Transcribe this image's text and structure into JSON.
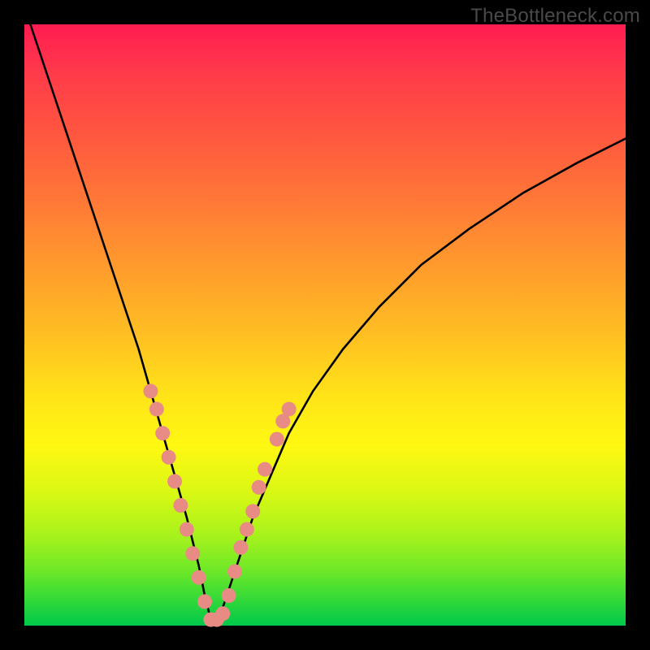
{
  "watermark": "TheBottleneck.com",
  "chart_data": {
    "type": "line",
    "title": "",
    "xlabel": "",
    "ylabel": "",
    "xlim": [
      0,
      100
    ],
    "ylim": [
      0,
      100
    ],
    "grid": false,
    "legend": false,
    "note": "Values are estimated from pixels. The line resembles an absolute-deviation / bottleneck curve with a sharp minimum near x≈31. Background gradient maps red(top)→green(bottom) to the same y-axis (high=bad, low=good).",
    "series": [
      {
        "name": "bottleneck-curve",
        "x": [
          1,
          4,
          7,
          10,
          13,
          16,
          19,
          21,
          23,
          25,
          27,
          29,
          30,
          31,
          32,
          33,
          34,
          36,
          38,
          41,
          44,
          48,
          53,
          59,
          66,
          74,
          83,
          92,
          100
        ],
        "y": [
          100,
          91,
          82,
          73,
          64,
          55,
          46,
          39,
          32,
          25,
          18,
          10,
          5,
          1,
          1,
          3,
          6,
          12,
          18,
          25,
          32,
          39,
          46,
          53,
          60,
          66,
          72,
          77,
          81
        ]
      }
    ],
    "markers": {
      "name": "highlighted-points",
      "note": "Salmon circular markers clustered near the valley on both branches.",
      "points": [
        {
          "x": 21,
          "y": 39
        },
        {
          "x": 22,
          "y": 36
        },
        {
          "x": 23,
          "y": 32
        },
        {
          "x": 24,
          "y": 28
        },
        {
          "x": 25,
          "y": 24
        },
        {
          "x": 26,
          "y": 20
        },
        {
          "x": 27,
          "y": 16
        },
        {
          "x": 28,
          "y": 12
        },
        {
          "x": 29,
          "y": 8
        },
        {
          "x": 30,
          "y": 4
        },
        {
          "x": 31,
          "y": 1
        },
        {
          "x": 32,
          "y": 1
        },
        {
          "x": 33,
          "y": 2
        },
        {
          "x": 34,
          "y": 5
        },
        {
          "x": 35,
          "y": 9
        },
        {
          "x": 36,
          "y": 13
        },
        {
          "x": 37,
          "y": 16
        },
        {
          "x": 38,
          "y": 19
        },
        {
          "x": 39,
          "y": 23
        },
        {
          "x": 40,
          "y": 26
        },
        {
          "x": 42,
          "y": 31
        },
        {
          "x": 43,
          "y": 34
        },
        {
          "x": 44,
          "y": 36
        }
      ]
    },
    "colors": {
      "curve": "#000000",
      "markers": "#e98b85",
      "gradient_top": "#ff1c52",
      "gradient_bottom": "#00c84a",
      "frame": "#000000"
    }
  }
}
